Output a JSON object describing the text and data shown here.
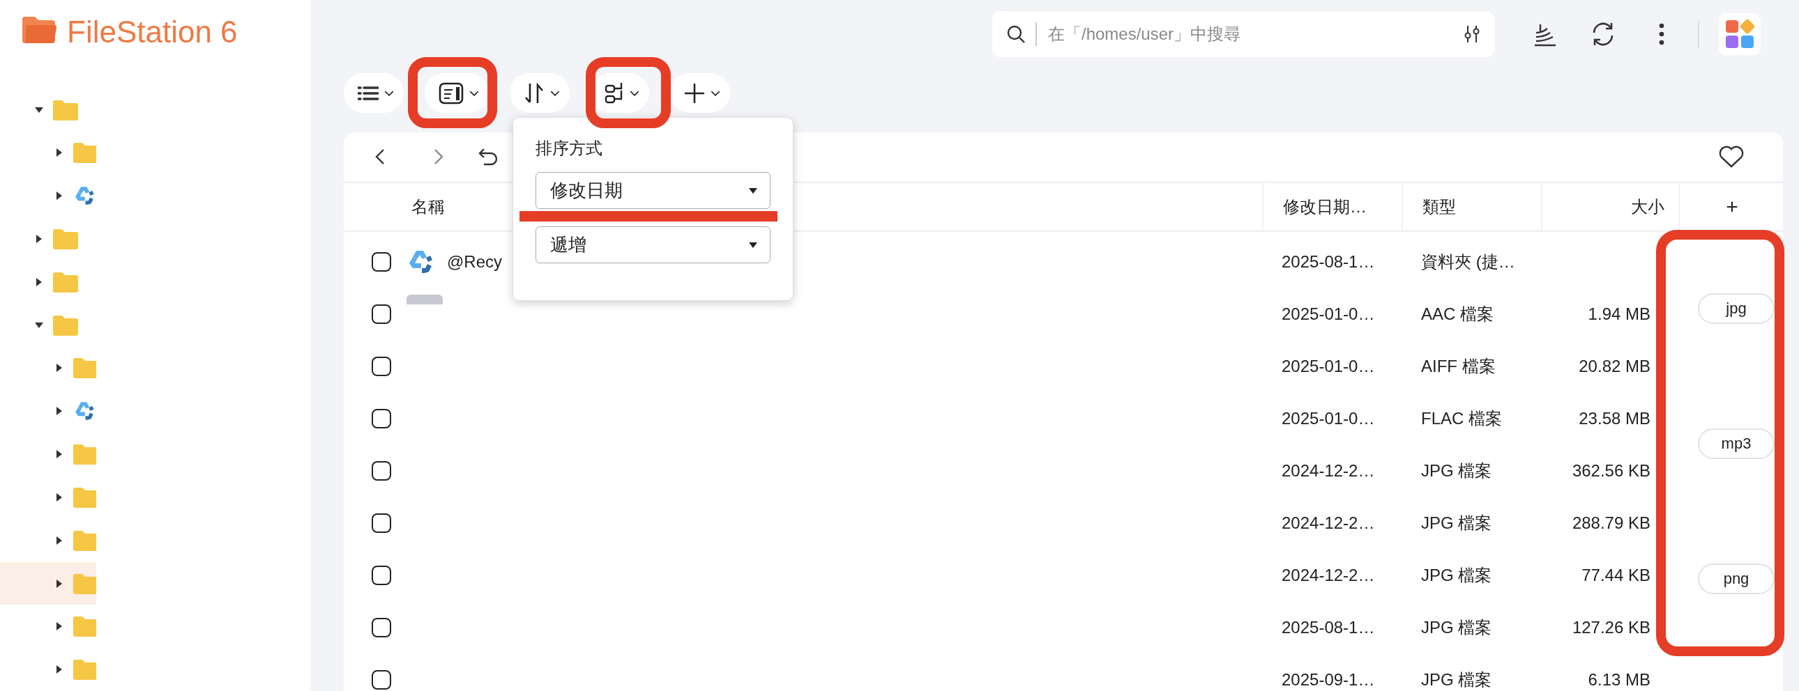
{
  "app": {
    "title": "FileStation 6"
  },
  "tree": [
    {
      "kind": "folder",
      "expanded": true,
      "selected": false,
      "children": [
        {
          "kind": "folder",
          "expanded": false,
          "selected": false
        },
        {
          "kind": "recycle",
          "expanded": false,
          "selected": false
        }
      ]
    },
    {
      "kind": "folder",
      "expanded": false,
      "selected": false
    },
    {
      "kind": "folder",
      "expanded": false,
      "selected": false
    },
    {
      "kind": "folder",
      "expanded": true,
      "selected": false,
      "children": [
        {
          "kind": "folder",
          "expanded": false,
          "selected": false
        },
        {
          "kind": "recycle",
          "expanded": false,
          "selected": false
        },
        {
          "kind": "folder",
          "expanded": false,
          "selected": false
        },
        {
          "kind": "folder",
          "expanded": false,
          "selected": false
        },
        {
          "kind": "folder",
          "expanded": false,
          "selected": false
        },
        {
          "kind": "folder",
          "expanded": false,
          "selected": true
        },
        {
          "kind": "folder",
          "expanded": false,
          "selected": false
        },
        {
          "kind": "folder",
          "expanded": false,
          "selected": false
        }
      ]
    }
  ],
  "search": {
    "placeholder": "在「/homes/user」中搜尋"
  },
  "sort_popup": {
    "title": "排序方式",
    "sort_by": "修改日期",
    "order": "遞增"
  },
  "table": {
    "columns": [
      "名稱",
      "修改日期…",
      "類型",
      "大小",
      "+"
    ],
    "rows": [
      {
        "checked": false,
        "kind": "recycle",
        "name": "@Recy",
        "modified": "2025-08-1…",
        "type": "資料夾 (捷…"
      },
      {
        "checked": false,
        "kind": "thumbnail",
        "modified": "2025-01-0…",
        "type": "AAC 檔案",
        "size": "1.94 MB"
      },
      {
        "checked": false,
        "kind": "blank",
        "modified": "2025-01-0…",
        "type": "AIFF 檔案",
        "size": "20.82 MB"
      },
      {
        "checked": false,
        "kind": "blank",
        "modified": "2025-01-0…",
        "type": "FLAC 檔案",
        "size": "23.58 MB"
      },
      {
        "checked": false,
        "kind": "blank",
        "modified": "2024-12-2…",
        "type": "JPG 檔案",
        "size": "362.56 KB"
      },
      {
        "checked": false,
        "kind": "blank",
        "modified": "2024-12-2…",
        "type": "JPG 檔案",
        "size": "288.79 KB"
      },
      {
        "checked": false,
        "kind": "blank",
        "modified": "2024-12-2…",
        "type": "JPG 檔案",
        "size": "77.44 KB"
      },
      {
        "checked": false,
        "kind": "blank",
        "modified": "2025-08-1…",
        "type": "JPG 檔案",
        "size": "127.26 KB"
      },
      {
        "checked": false,
        "kind": "blank",
        "modified": "2025-09-1…",
        "type": "JPG 檔案",
        "size": "6.13 MB"
      }
    ]
  },
  "tags": [
    "jpg",
    "mp3",
    "png"
  ]
}
